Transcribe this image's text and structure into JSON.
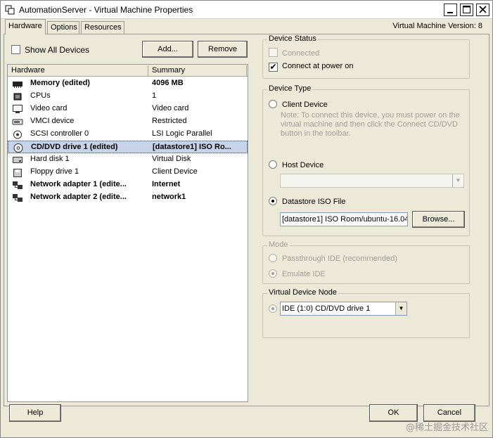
{
  "window": {
    "title": "AutomationServer - Virtual Machine Properties",
    "minimize": "▁",
    "maximize": "☐",
    "close": "✕"
  },
  "tabs": [
    {
      "label": "Hardware",
      "active": true
    },
    {
      "label": "Options",
      "active": false
    },
    {
      "label": "Resources",
      "active": false
    }
  ],
  "vm_version": "Virtual Machine Version: 8",
  "left": {
    "show_all_label": "Show All Devices",
    "show_all_checked": false,
    "add_label": "Add...",
    "remove_label": "Remove",
    "columns": [
      "Hardware",
      "Summary"
    ],
    "rows": [
      {
        "icon": "memory-icon",
        "name": "Memory (edited)",
        "summary": "4096 MB",
        "bold": true,
        "selected": false
      },
      {
        "icon": "cpu-icon",
        "name": "CPUs",
        "summary": "1",
        "bold": false,
        "selected": false
      },
      {
        "icon": "monitor-icon",
        "name": "Video card",
        "summary": "Video card",
        "bold": false,
        "selected": false
      },
      {
        "icon": "vmci-icon",
        "name": "VMCI device",
        "summary": "Restricted",
        "bold": false,
        "selected": false
      },
      {
        "icon": "scsi-icon",
        "name": "SCSI controller 0",
        "summary": "LSI Logic Parallel",
        "bold": false,
        "selected": false
      },
      {
        "icon": "cd-icon",
        "name": "CD/DVD drive 1 (edited)",
        "summary": "[datastore1] ISO Ro...",
        "bold": true,
        "selected": true
      },
      {
        "icon": "hard-disk-icon",
        "name": "Hard disk 1",
        "summary": "Virtual Disk",
        "bold": false,
        "selected": false
      },
      {
        "icon": "floppy-icon",
        "name": "Floppy drive 1",
        "summary": "Client Device",
        "bold": false,
        "selected": false
      },
      {
        "icon": "network-icon",
        "name": "Network adapter 1 (edite...",
        "summary": "Internet",
        "bold": true,
        "selected": false
      },
      {
        "icon": "network-icon",
        "name": "Network adapter 2 (edite...",
        "summary": "network1",
        "bold": true,
        "selected": false
      }
    ]
  },
  "device_status": {
    "title": "Device Status",
    "connected_label": "Connected",
    "connected_checked": false,
    "power_on_label": "Connect at power on",
    "power_on_checked": true,
    "check_mark": "✔"
  },
  "device_type": {
    "title": "Device Type",
    "client_label": "Client Device",
    "client_note": "Note: To connect this device, you must power on the virtual machine and then click the Connect CD/DVD button in the toolbar.",
    "host_label": "Host Device",
    "host_value": "",
    "datastore_label": "Datastore ISO File",
    "datastore_value": "[datastore1] ISO Room/ubuntu-16.04",
    "browse_label": "Browse...",
    "selected": "datastore"
  },
  "mode": {
    "title": "Mode",
    "passthrough_label": "Passthrough IDE (recommended)",
    "emulate_label": "Emulate IDE",
    "selected": "emulate"
  },
  "vdn": {
    "title": "Virtual Device Node",
    "value": "IDE (1:0) CD/DVD drive 1"
  },
  "footer": {
    "help_label": "Help",
    "ok_label": "OK",
    "cancel_label": "Cancel"
  },
  "watermark": "@稀土掘金技术社区",
  "colors": {
    "window_bg": "#ece9d8",
    "selection": "#c6d3e8",
    "disabled_text": "#a09f98"
  }
}
